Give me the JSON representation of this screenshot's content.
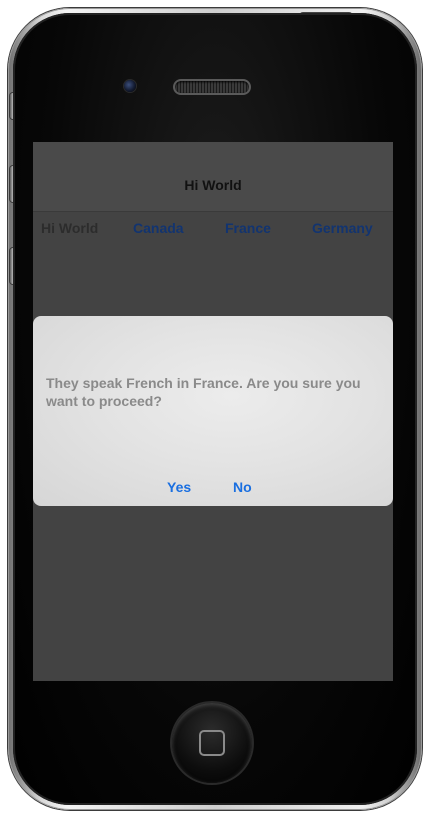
{
  "navigation_bar": {
    "title": "Hi World"
  },
  "tabs": [
    {
      "label": "Hi World",
      "selected": true
    },
    {
      "label": "Canada",
      "selected": false
    },
    {
      "label": "France",
      "selected": false
    },
    {
      "label": "Germany",
      "selected": false
    }
  ],
  "alert": {
    "message": "They speak French in France.  Are you sure you want to proceed?",
    "buttons": {
      "yes": "Yes",
      "no": "No"
    }
  },
  "colors": {
    "alert_button": "#1a6fe0",
    "tab_text": "#123470",
    "screen_dim": "#434343"
  }
}
